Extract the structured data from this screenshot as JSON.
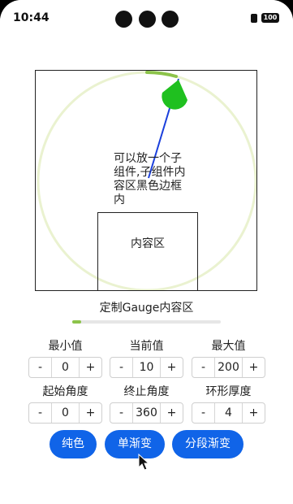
{
  "status_bar": {
    "time": "10:44",
    "battery": "100"
  },
  "gauge": {
    "value": 10,
    "min": 0,
    "max": 200,
    "start_angle": 0,
    "end_angle": 360,
    "stroke_width": 4,
    "inner_text": "可以放一个子组件,子组件内容区黑色边框内",
    "inner_box_label": "内容区",
    "pointer_color": "#1a3fdc",
    "indicator_color": "#1fc01f",
    "ring_color": "#eaf2d0",
    "progress_color": "#8cc34a"
  },
  "caption": "定制Gauge内容区",
  "progress": {
    "fraction": 0.06
  },
  "controls": [
    {
      "label": "最小值",
      "value": "0",
      "minus": "-",
      "plus": "+"
    },
    {
      "label": "当前值",
      "value": "10",
      "minus": "-",
      "plus": "+"
    },
    {
      "label": "最大值",
      "value": "200",
      "minus": "-",
      "plus": "+"
    },
    {
      "label": "起始角度",
      "value": "0",
      "minus": "-",
      "plus": "+"
    },
    {
      "label": "终止角度",
      "value": "360",
      "minus": "-",
      "plus": "+"
    },
    {
      "label": "环形厚度",
      "value": "4",
      "minus": "-",
      "plus": "+"
    }
  ],
  "buttons": {
    "solid": "纯色",
    "single_gradient": "单渐变",
    "segment_gradient": "分段渐变"
  },
  "accent_color": "#1064e8"
}
